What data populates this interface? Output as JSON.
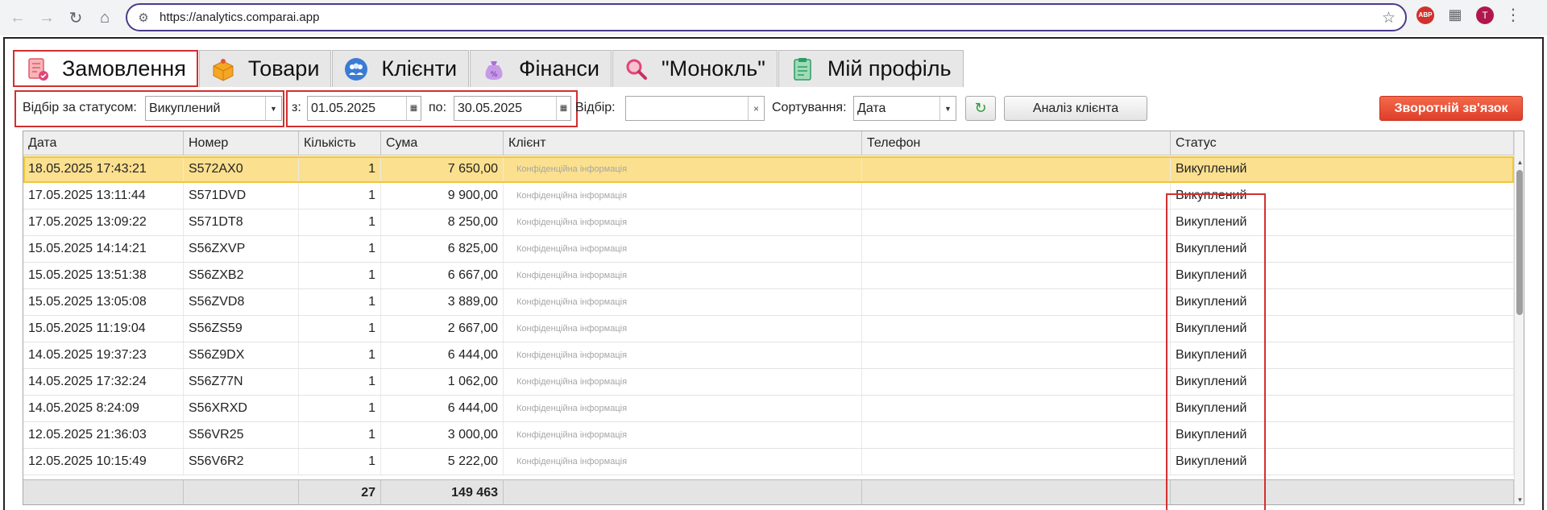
{
  "browser": {
    "url": "https://analytics.comparai.app",
    "avatar_letter": "T",
    "abp_label": "ABP"
  },
  "tabs": [
    {
      "label": "Замовлення",
      "icon": "orders-icon"
    },
    {
      "label": "Товари",
      "icon": "box-icon"
    },
    {
      "label": "Клієнти",
      "icon": "clients-icon"
    },
    {
      "label": "Фінанси",
      "icon": "money-bag-icon"
    },
    {
      "label": "\"Монокль\"",
      "icon": "magnifier-icon"
    },
    {
      "label": "Мій профіль",
      "icon": "profile-icon"
    }
  ],
  "filters": {
    "status_label": "Відбір за статусом:",
    "status_value": "Викуплений",
    "from_label": "з:",
    "from_value": "01.05.2025",
    "to_label": "по:",
    "to_value": "30.05.2025",
    "filter_label": "Відбір:",
    "filter_value": "",
    "sort_label": "Сортування:",
    "sort_value": "Дата",
    "analysis_button": "Аналіз клієнта",
    "feedback_button": "Зворотній зв'язок"
  },
  "table": {
    "headers": [
      "Дата",
      "Номер",
      "Кількість",
      "Сума",
      "Клієнт",
      "Телефон",
      "Статус"
    ],
    "rows": [
      [
        "18.05.2025 17:43:21",
        "S572AX0",
        "1",
        "7 650,00",
        "Конфіденційна інформація",
        "",
        "Викуплений"
      ],
      [
        "17.05.2025 13:11:44",
        "S571DVD",
        "1",
        "9 900,00",
        "Конфіденційна інформація",
        "",
        "Викуплений"
      ],
      [
        "17.05.2025 13:09:22",
        "S571DT8",
        "1",
        "8 250,00",
        "Конфіденційна інформація",
        "",
        "Викуплений"
      ],
      [
        "15.05.2025 14:14:21",
        "S56ZXVP",
        "1",
        "6 825,00",
        "Конфіденційна інформація",
        "",
        "Викуплений"
      ],
      [
        "15.05.2025 13:51:38",
        "S56ZXB2",
        "1",
        "6 667,00",
        "Конфіденційна інформація",
        "",
        "Викуплений"
      ],
      [
        "15.05.2025 13:05:08",
        "S56ZVD8",
        "1",
        "3 889,00",
        "Конфіденційна інформація",
        "",
        "Викуплений"
      ],
      [
        "15.05.2025 11:19:04",
        "S56ZS59",
        "1",
        "2 667,00",
        "Конфіденційна інформація",
        "",
        "Викуплений"
      ],
      [
        "14.05.2025 19:37:23",
        "S56Z9DX",
        "1",
        "6 444,00",
        "Конфіденційна інформація",
        "",
        "Викуплений"
      ],
      [
        "14.05.2025 17:32:24",
        "S56Z77N",
        "1",
        "1 062,00",
        "Конфіденційна інформація",
        "",
        "Викуплений"
      ],
      [
        "14.05.2025 8:24:09",
        "S56XRXD",
        "1",
        "6 444,00",
        "Конфіденційна інформація",
        "",
        "Викуплений"
      ],
      [
        "12.05.2025 21:36:03",
        "S56VR25",
        "1",
        "3 000,00",
        "Конфіденційна інформація",
        "",
        "Викуплений"
      ],
      [
        "12.05.2025 10:15:49",
        "S56V6R2",
        "1",
        "5 222,00",
        "Конфіденційна інформація",
        "",
        "Викуплений"
      ]
    ],
    "totals": {
      "quantity": "27",
      "sum": "149 463"
    }
  },
  "colors": {
    "accent_red": "#d32f2f",
    "selected_row": "#fbe08f",
    "feedback_button": "#e8472f"
  }
}
